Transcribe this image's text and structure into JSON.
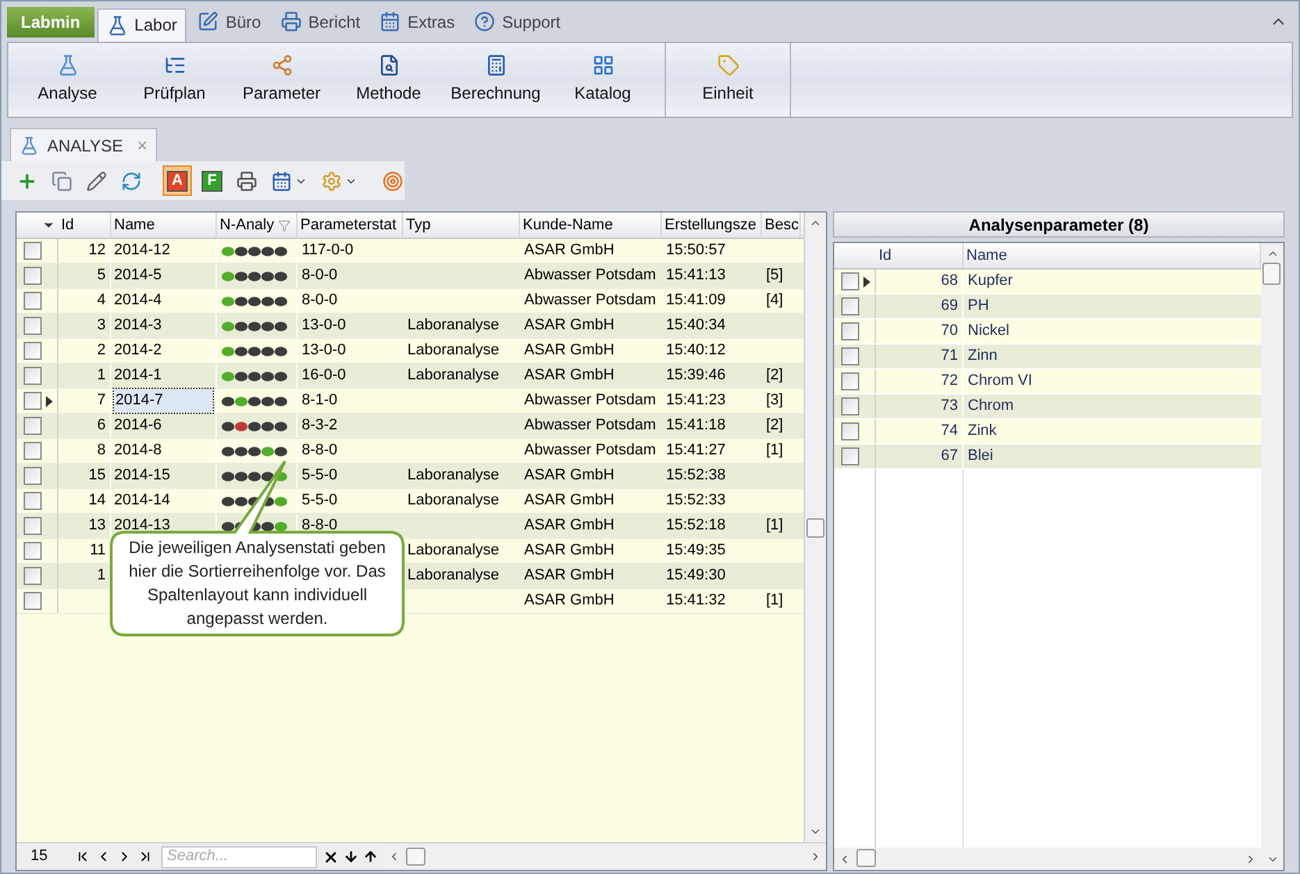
{
  "app_button": {
    "label": "Labmin"
  },
  "ribbon_tabs": [
    {
      "label": "Labor",
      "selected": true
    },
    {
      "label": "Büro",
      "selected": false
    },
    {
      "label": "Bericht",
      "selected": false
    },
    {
      "label": "Extras",
      "selected": false
    },
    {
      "label": "Support",
      "selected": false
    }
  ],
  "ribbon_groups": [
    [
      {
        "label": "Analyse",
        "kind": "flask"
      },
      {
        "label": "Prüfplan",
        "kind": "tree"
      },
      {
        "label": "Parameter",
        "kind": "nodes"
      },
      {
        "label": "Methode",
        "kind": "method"
      },
      {
        "label": "Berechnung",
        "kind": "calc"
      },
      {
        "label": "Katalog",
        "kind": "catalog"
      }
    ],
    [
      {
        "label": "Einheit",
        "kind": "unit"
      }
    ]
  ],
  "document_tab": {
    "label": "ANALYSE",
    "close": "×"
  },
  "toolbar": [
    {
      "kind": "add",
      "pressed": false
    },
    {
      "kind": "copy",
      "pressed": false
    },
    {
      "kind": "edit",
      "pressed": false
    },
    {
      "kind": "refresh",
      "pressed": false
    },
    {
      "kind": "letter",
      "label": "A",
      "color": "#e2452a",
      "pressed": true
    },
    {
      "kind": "letter",
      "label": "F",
      "color": "#35a02c",
      "pressed": false
    },
    {
      "kind": "print",
      "pressed": false
    },
    {
      "kind": "calendar",
      "pressed": false,
      "dropdown": true
    },
    {
      "kind": "gears",
      "pressed": false,
      "dropdown": true
    },
    {
      "kind": "target",
      "pressed": false
    }
  ],
  "grid": {
    "columns": [
      "Id",
      "Name",
      "N-Analy",
      "Parameterstat",
      "Typ",
      "Kunde-Name",
      "Erstellungsze",
      "Besc"
    ],
    "rows": [
      {
        "checked": false,
        "current": false,
        "id": "12",
        "name": "2014-12",
        "status": [
          {
            "color": "#52ad2a"
          },
          {
            "color": "#3c3c3c"
          },
          {
            "color": "#3c3c3c"
          },
          {
            "color": "#3c3c3c"
          },
          {
            "color": "#3c3c3c"
          }
        ],
        "parameter_status": "117-0-0",
        "customer": "ASAR GmbH",
        "created": "15:50:57"
      },
      {
        "checked": false,
        "current": false,
        "id": "5",
        "name": "2014-5",
        "status": [
          {
            "color": "#52ad2a"
          },
          {
            "color": "#3c3c3c"
          },
          {
            "color": "#3c3c3c"
          },
          {
            "color": "#3c3c3c"
          },
          {
            "color": "#3c3c3c"
          }
        ],
        "parameter_status": "8-0-0",
        "customer": "Abwasser Potsdam",
        "created": "15:41:13",
        "besc": "[5]"
      },
      {
        "checked": false,
        "current": false,
        "id": "4",
        "name": "2014-4",
        "status": [
          {
            "color": "#52ad2a"
          },
          {
            "color": "#3c3c3c"
          },
          {
            "color": "#3c3c3c"
          },
          {
            "color": "#3c3c3c"
          },
          {
            "color": "#3c3c3c"
          }
        ],
        "parameter_status": "8-0-0",
        "customer": "Abwasser Potsdam",
        "created": "15:41:09",
        "besc": "[4]"
      },
      {
        "checked": false,
        "current": false,
        "id": "3",
        "name": "2014-3",
        "status": [
          {
            "color": "#52ad2a"
          },
          {
            "color": "#3c3c3c"
          },
          {
            "color": "#3c3c3c"
          },
          {
            "color": "#3c3c3c"
          },
          {
            "color": "#3c3c3c"
          }
        ],
        "parameter_status": "13-0-0",
        "type": "Laboranalyse",
        "customer": "ASAR GmbH",
        "created": "15:40:34"
      },
      {
        "checked": false,
        "current": false,
        "id": "2",
        "name": "2014-2",
        "status": [
          {
            "color": "#52ad2a"
          },
          {
            "color": "#3c3c3c"
          },
          {
            "color": "#3c3c3c"
          },
          {
            "color": "#3c3c3c"
          },
          {
            "color": "#3c3c3c"
          }
        ],
        "parameter_status": "13-0-0",
        "type": "Laboranalyse",
        "customer": "ASAR GmbH",
        "created": "15:40:12"
      },
      {
        "checked": false,
        "current": false,
        "id": "1",
        "name": "2014-1",
        "status": [
          {
            "color": "#52ad2a"
          },
          {
            "color": "#3c3c3c"
          },
          {
            "color": "#3c3c3c"
          },
          {
            "color": "#3c3c3c"
          },
          {
            "color": "#3c3c3c"
          }
        ],
        "parameter_status": "16-0-0",
        "type": "Laboranalyse",
        "customer": "ASAR GmbH",
        "created": "15:39:46",
        "besc": "[2]"
      },
      {
        "checked": false,
        "current": true,
        "id": "7",
        "name": "2014-7",
        "status": [
          {
            "color": "#3c3c3c"
          },
          {
            "color": "#52ad2a"
          },
          {
            "color": "#3c3c3c"
          },
          {
            "color": "#3c3c3c"
          },
          {
            "color": "#3c3c3c"
          }
        ],
        "parameter_status": "8-1-0",
        "customer": "Abwasser Potsdam",
        "created": "15:41:23",
        "besc": "[3]"
      },
      {
        "checked": false,
        "current": false,
        "id": "6",
        "name": "2014-6",
        "status": [
          {
            "color": "#3c3c3c"
          },
          {
            "color": "#c23a36"
          },
          {
            "color": "#3c3c3c"
          },
          {
            "color": "#3c3c3c"
          },
          {
            "color": "#3c3c3c"
          }
        ],
        "parameter_status": "8-3-2",
        "customer": "Abwasser Potsdam",
        "created": "15:41:18",
        "besc": "[2]"
      },
      {
        "checked": false,
        "current": false,
        "id": "8",
        "name": "2014-8",
        "status": [
          {
            "color": "#3c3c3c"
          },
          {
            "color": "#3c3c3c"
          },
          {
            "color": "#3c3c3c"
          },
          {
            "color": "#52ad2a"
          },
          {
            "color": "#3c3c3c"
          }
        ],
        "parameter_status": "8-8-0",
        "customer": "Abwasser Potsdam",
        "created": "15:41:27",
        "besc": "[1]"
      },
      {
        "checked": false,
        "current": false,
        "id": "15",
        "name": "2014-15",
        "status": [
          {
            "color": "#3c3c3c"
          },
          {
            "color": "#3c3c3c"
          },
          {
            "color": "#3c3c3c"
          },
          {
            "color": "#3c3c3c"
          },
          {
            "color": "#52ad2a"
          }
        ],
        "parameter_status": "5-5-0",
        "type": "Laboranalyse",
        "customer": "ASAR GmbH",
        "created": "15:52:38"
      },
      {
        "checked": false,
        "current": false,
        "id": "14",
        "name": "2014-14",
        "status": [
          {
            "color": "#3c3c3c"
          },
          {
            "color": "#3c3c3c"
          },
          {
            "color": "#3c3c3c"
          },
          {
            "color": "#3c3c3c"
          },
          {
            "color": "#52ad2a"
          }
        ],
        "parameter_status": "5-5-0",
        "type": "Laboranalyse",
        "customer": "ASAR GmbH",
        "created": "15:52:33"
      },
      {
        "checked": false,
        "current": false,
        "id": "13",
        "name": "2014-13",
        "status": [
          {
            "color": "#3c3c3c"
          },
          {
            "color": "#3c3c3c"
          },
          {
            "color": "#3c3c3c"
          },
          {
            "color": "#3c3c3c"
          },
          {
            "color": "#52ad2a"
          }
        ],
        "parameter_status": "8-8-0",
        "customer": "ASAR GmbH",
        "created": "15:52:18",
        "besc": "[1]"
      },
      {
        "checked": false,
        "current": false,
        "id": "11",
        "type": "Laboranalyse",
        "customer": "ASAR GmbH",
        "created": "15:49:35"
      },
      {
        "checked": false,
        "current": false,
        "id": "1",
        "type": "Laboranalyse",
        "customer": "ASAR GmbH",
        "created": "15:49:30"
      },
      {
        "checked": false,
        "current": false,
        "customer": "ASAR GmbH",
        "created": "15:41:32",
        "besc": "[1]"
      }
    ],
    "footer": {
      "count": "15",
      "search_placeholder": "Search..."
    }
  },
  "callout": {
    "text": "Die jeweiligen Analysenstati geben hier die Sortierreihenfolge vor. Das Spaltenlayout kann individuell angepasst werden."
  },
  "parameters": {
    "title": "Analysenparameter (8)",
    "columns": [
      "Id",
      "Name"
    ],
    "rows": [
      {
        "checked": false,
        "current": true,
        "id": "68",
        "name": "Kupfer"
      },
      {
        "checked": false,
        "current": false,
        "id": "69",
        "name": "PH"
      },
      {
        "checked": false,
        "current": false,
        "id": "70",
        "name": "Nickel"
      },
      {
        "checked": false,
        "current": false,
        "id": "71",
        "name": "Zinn"
      },
      {
        "checked": false,
        "current": false,
        "id": "72",
        "name": "Chrom VI"
      },
      {
        "checked": false,
        "current": false,
        "id": "73",
        "name": "Chrom"
      },
      {
        "checked": false,
        "current": false,
        "id": "74",
        "name": "Zink"
      },
      {
        "checked": false,
        "current": false,
        "id": "67",
        "name": "Blei"
      }
    ]
  }
}
